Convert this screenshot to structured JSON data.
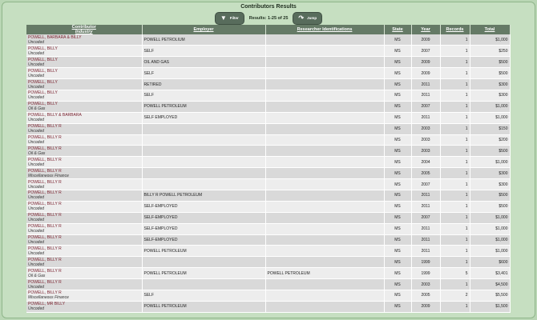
{
  "page": {
    "title": "Contributors Results",
    "results_text": "Results: 1-25 of 25",
    "filter_label": "Filter",
    "jump_label": "Jump"
  },
  "columns": {
    "contributor": "Contributor",
    "industry": "Industry",
    "employer": "Employer",
    "researcher": "Researcher Identifications",
    "state": "State",
    "year": "Year",
    "records": "Records",
    "total": "Total"
  },
  "rows": [
    {
      "name": "POWELL, BARBARA & BILLY",
      "industry": "Uncoded",
      "employer": "POWELL PETROLIUM",
      "researcher": "",
      "state": "MS",
      "year": "2009",
      "records": "1",
      "total": "$1,000"
    },
    {
      "name": "POWELL, BILLY",
      "industry": "Uncoded",
      "employer": "SELF",
      "researcher": "",
      "state": "MS",
      "year": "2007",
      "records": "1",
      "total": "$250"
    },
    {
      "name": "POWELL, BILLY",
      "industry": "Uncoded",
      "employer": "OIL AND GAS",
      "researcher": "",
      "state": "MS",
      "year": "2009",
      "records": "1",
      "total": "$500"
    },
    {
      "name": "POWELL, BILLY",
      "industry": "Uncoded",
      "employer": "SELF",
      "researcher": "",
      "state": "MS",
      "year": "2009",
      "records": "1",
      "total": "$500"
    },
    {
      "name": "POWELL, BILLY",
      "industry": "Uncoded",
      "employer": "RETIRED",
      "researcher": "",
      "state": "MS",
      "year": "2011",
      "records": "1",
      "total": "$300"
    },
    {
      "name": "POWELL, BILLY",
      "industry": "Uncoded",
      "employer": "SELF",
      "researcher": "",
      "state": "MS",
      "year": "2011",
      "records": "1",
      "total": "$300"
    },
    {
      "name": "POWELL, BILLY",
      "industry": "Oil & Gas",
      "employer": "POWELL PETROLEUM",
      "researcher": "",
      "state": "MS",
      "year": "2007",
      "records": "1",
      "total": "$1,000"
    },
    {
      "name": "POWELL, BILLY & BARBARA",
      "industry": "Uncoded",
      "employer": "SELF EMPLOYED",
      "researcher": "",
      "state": "MS",
      "year": "2011",
      "records": "1",
      "total": "$1,000"
    },
    {
      "name": "POWELL, BILLY R",
      "industry": "Uncoded",
      "employer": "",
      "researcher": "",
      "state": "MS",
      "year": "2003",
      "records": "1",
      "total": "$150"
    },
    {
      "name": "POWELL, BILLY R",
      "industry": "Uncoded",
      "employer": "",
      "researcher": "",
      "state": "MS",
      "year": "2003",
      "records": "1",
      "total": "$200"
    },
    {
      "name": "POWELL, BILLY R",
      "industry": "Oil & Gas",
      "employer": "",
      "researcher": "",
      "state": "MS",
      "year": "2003",
      "records": "1",
      "total": "$500"
    },
    {
      "name": "POWELL, BILLY R",
      "industry": "Uncoded",
      "employer": "",
      "researcher": "",
      "state": "MS",
      "year": "2004",
      "records": "1",
      "total": "$1,000"
    },
    {
      "name": "POWELL, BILLY R",
      "industry": "Miscellaneous Finance",
      "employer": "",
      "researcher": "",
      "state": "MS",
      "year": "2005",
      "records": "1",
      "total": "$300"
    },
    {
      "name": "POWELL, BILLY R",
      "industry": "Uncoded",
      "employer": "",
      "researcher": "",
      "state": "MS",
      "year": "2007",
      "records": "1",
      "total": "$300"
    },
    {
      "name": "POWELL, BILLY R",
      "industry": "Uncoded",
      "employer": "BILLY R POWELL PETROLEUM",
      "researcher": "",
      "state": "MS",
      "year": "2011",
      "records": "1",
      "total": "$500"
    },
    {
      "name": "POWELL, BILLY R",
      "industry": "Uncoded",
      "employer": "SELF-EMPLOYED",
      "researcher": "",
      "state": "MS",
      "year": "2011",
      "records": "1",
      "total": "$500"
    },
    {
      "name": "POWELL, BILLY R",
      "industry": "Uncoded",
      "employer": "SELF-EMPLOYED",
      "researcher": "",
      "state": "MS",
      "year": "2007",
      "records": "1",
      "total": "$1,000"
    },
    {
      "name": "POWELL, BILLY R",
      "industry": "Uncoded",
      "employer": "SELF-EMPLOYED",
      "researcher": "",
      "state": "MS",
      "year": "2011",
      "records": "1",
      "total": "$1,000"
    },
    {
      "name": "POWELL, BILLY R",
      "industry": "Uncoded",
      "employer": "SELF-EMPLOYED",
      "researcher": "",
      "state": "MS",
      "year": "2011",
      "records": "1",
      "total": "$1,000"
    },
    {
      "name": "POWELL, BILLY R",
      "industry": "Uncoded",
      "employer": "POWELL PETROLEUM",
      "researcher": "",
      "state": "MS",
      "year": "2011",
      "records": "1",
      "total": "$1,000"
    },
    {
      "name": "POWELL, BILLY R",
      "industry": "Uncoded",
      "employer": "",
      "researcher": "",
      "state": "MS",
      "year": "1999",
      "records": "1",
      "total": "$600"
    },
    {
      "name": "POWELL, BILLY R",
      "industry": "Oil & Gas",
      "employer": "POWELL PETROLEUM",
      "researcher": "POWELL PETROLEUM",
      "state": "MS",
      "year": "1999",
      "records": "5",
      "total": "$3,401"
    },
    {
      "name": "POWELL, BILLY R",
      "industry": "Uncoded",
      "employer": "",
      "researcher": "",
      "state": "MS",
      "year": "2003",
      "records": "1",
      "total": "$4,500"
    },
    {
      "name": "POWELL, BILLY R",
      "industry": "Miscellaneous Finance",
      "employer": "SELF",
      "researcher": "",
      "state": "MS",
      "year": "2005",
      "records": "2",
      "total": "$5,500"
    },
    {
      "name": "POWELL, MR BILLY",
      "industry": "Uncoded",
      "employer": "POWELL PETROLEUM",
      "researcher": "",
      "state": "MS",
      "year": "2009",
      "records": "1",
      "total": "$1,500"
    }
  ]
}
